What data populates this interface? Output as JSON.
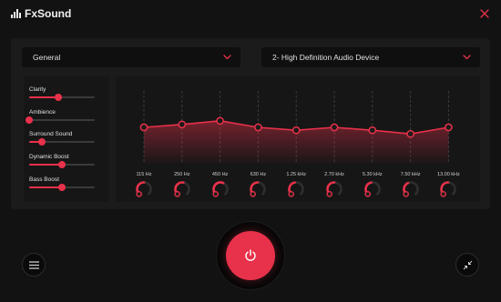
{
  "app": {
    "name": "FxSound"
  },
  "colors": {
    "accent": "#e8314a",
    "background": "#121212",
    "panel": "#1b1b1b"
  },
  "preset": {
    "selected": "General"
  },
  "output_device": {
    "selected": "2- High Definition Audio Device"
  },
  "effects": [
    {
      "label": "Clarity",
      "value": 0.45
    },
    {
      "label": "Ambience",
      "value": 0
    },
    {
      "label": "Surround Sound",
      "value": 0.2
    },
    {
      "label": "Dynamic Boost",
      "value": 0.5
    },
    {
      "label": "Bass Boost",
      "value": 0.5
    }
  ],
  "equalizer": {
    "bands": [
      {
        "freq": "115 Hz",
        "level": 0.5
      },
      {
        "freq": "250 Hz",
        "level": 0.54
      },
      {
        "freq": "450 Hz",
        "level": 0.59
      },
      {
        "freq": "630 Hz",
        "level": 0.5
      },
      {
        "freq": "1.25 kHz",
        "level": 0.46
      },
      {
        "freq": "2.70 kHz",
        "level": 0.5
      },
      {
        "freq": "5.30 kHz",
        "level": 0.46
      },
      {
        "freq": "7.50 kHz",
        "level": 0.41
      },
      {
        "freq": "13.00 kHz",
        "level": 0.5
      }
    ]
  },
  "icons": {
    "logo": "equalizer-bars-icon",
    "close": "close-icon",
    "dropdown": "chevron-down-icon",
    "menu": "hamburger-menu-icon",
    "power": "power-icon",
    "minimize": "collapse-arrows-icon"
  }
}
